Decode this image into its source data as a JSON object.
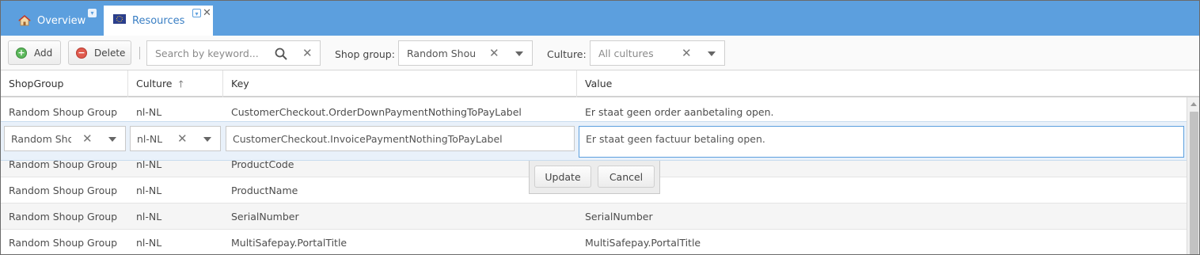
{
  "tabs": [
    {
      "label": "Overview",
      "icon": "home-icon",
      "active": false
    },
    {
      "label": "Resources",
      "icon": "flag-icon",
      "active": true
    }
  ],
  "toolbar": {
    "add_label": "Add",
    "delete_label": "Delete",
    "search_placeholder": "Search by keyword...",
    "shop_group_label": "Shop group:",
    "shop_group_value": "Random Shoup Group",
    "culture_label": "Culture:",
    "culture_value": "All cultures"
  },
  "grid": {
    "columns": [
      "ShopGroup",
      "Culture",
      "Key",
      "Value"
    ],
    "sort_column": "Culture",
    "sort_direction": "ascending",
    "rows_before": [
      {
        "shopgroup": "Random Shoup Group",
        "culture": "nl-NL",
        "key": "CustomerCheckout.OrderDownPaymentNothingToPayLabel",
        "value": "Er staat geen order aanbetaling open."
      }
    ],
    "rows_after": [
      {
        "shopgroup": "Random Shoup Group",
        "culture": "nl-NL",
        "key": "ProductCode",
        "value": ""
      },
      {
        "shopgroup": "Random Shoup Group",
        "culture": "nl-NL",
        "key": "ProductName",
        "value": ""
      },
      {
        "shopgroup": "Random Shoup Group",
        "culture": "nl-NL",
        "key": "SerialNumber",
        "value": "SerialNumber"
      },
      {
        "shopgroup": "Random Shoup Group",
        "culture": "nl-NL",
        "key": "MultiSafepay.PortalTitle",
        "value": "MultiSafepay.PortalTitle"
      }
    ],
    "edit_row": {
      "shopgroup": "Random Shoup Group",
      "culture": "nl-NL",
      "key": "CustomerCheckout.InvoicePaymentNothingToPayLabel",
      "value_parts": [
        "Er",
        " ",
        "staat",
        " ",
        "geen",
        " ",
        "factuur",
        " ",
        "betaling",
        " open."
      ]
    },
    "edit_actions": {
      "update_label": "Update",
      "cancel_label": "Cancel"
    }
  }
}
